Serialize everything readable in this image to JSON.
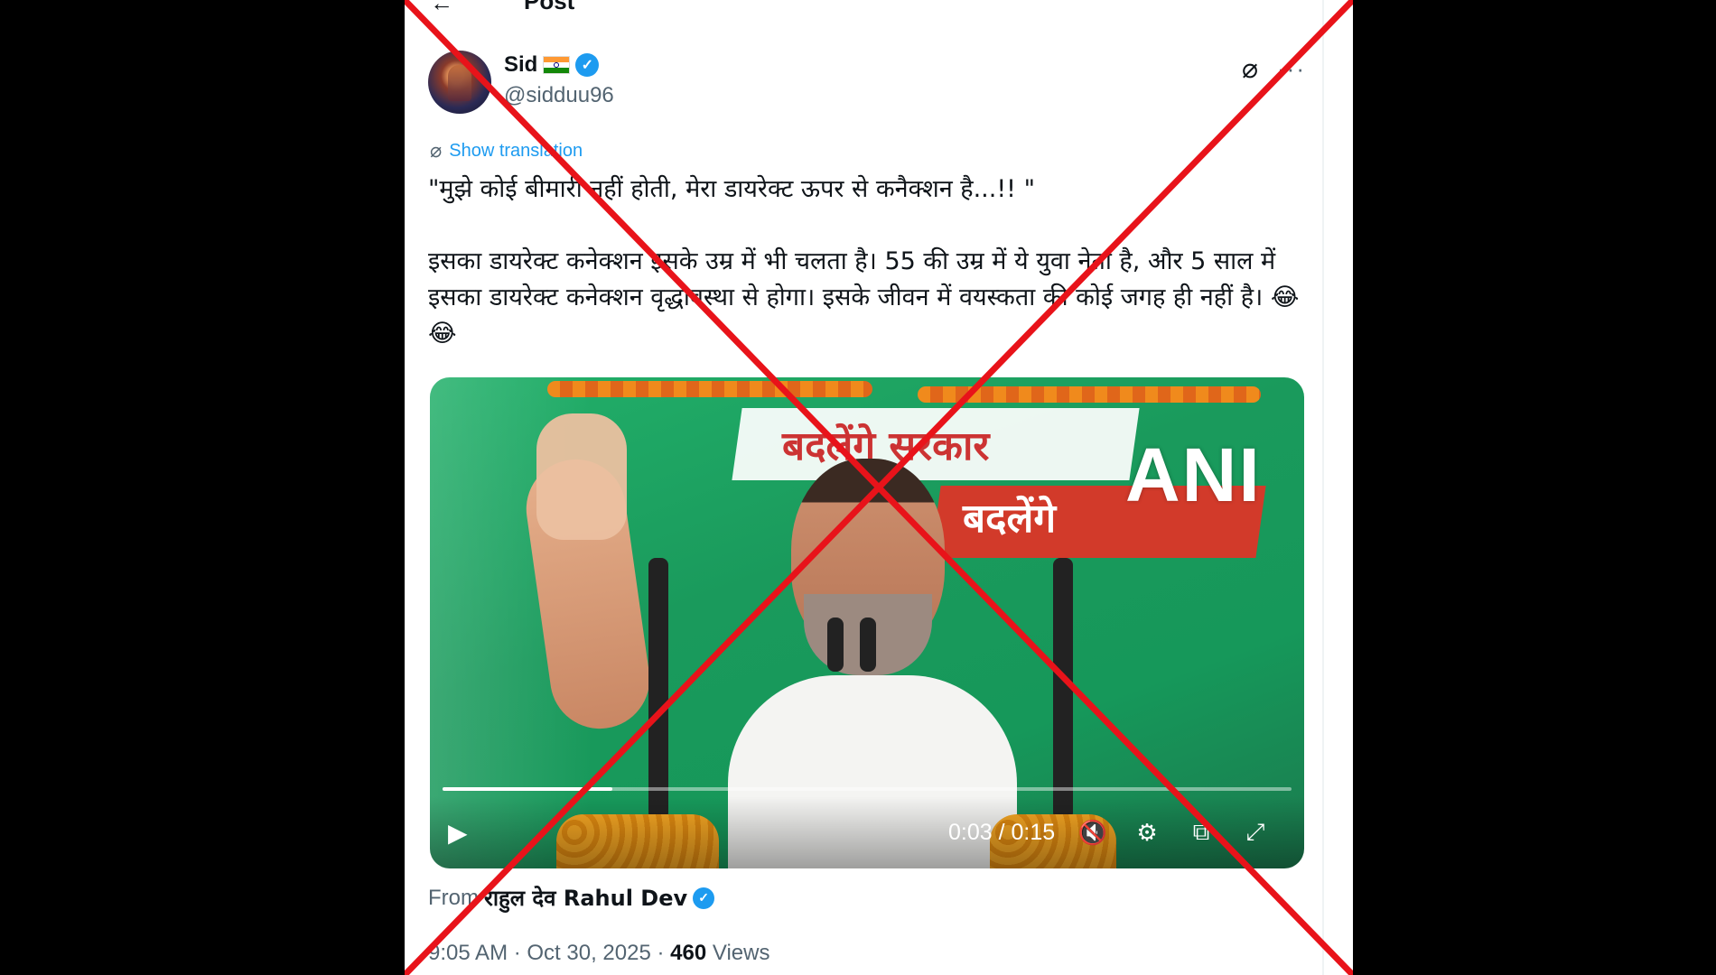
{
  "header": {
    "title": "Post"
  },
  "author": {
    "name": "Sid",
    "handle": "@sidduu96"
  },
  "icons": {
    "back": "arrow-left-icon",
    "grok": "grok-icon",
    "more": "more-dots-icon",
    "translate": "translate-icon",
    "play": "play-icon",
    "mute": "mute-icon",
    "settings": "settings-icon",
    "pip": "pip-icon",
    "fullscreen": "fullscreen-icon"
  },
  "tweet": {
    "translate_label": "Show translation",
    "line1": "\"मुझे कोई बीमारी नहीं होती, मेरा डायरेक्ट ऊपर से कनैक्शन है...!! \"",
    "line2": "इसका डायरेक्ट कनेक्शन इसके उम्र में भी चलता है। 55 की उम्र में ये युवा नेता है, और 5 साल में इसका डायरेक्ट कनेक्शन वृद्धावस्था से होगा। इसके जीवन में वयस्कता की कोई जगह ही नहीं है। 😂😂"
  },
  "video": {
    "banner_line1": "बदलेंगे सरकार",
    "banner_line2": "बदलेंगे",
    "watermark": "ANI",
    "time_current": "0:03",
    "time_separator": " / ",
    "time_total": "0:15",
    "progress": 0.2
  },
  "attribution": {
    "from_label": "From",
    "from_name": "राहुल देव Rahul Dev"
  },
  "meta": {
    "time": "9:05 AM",
    "sep": " · ",
    "date": "Oct 30, 2025",
    "views_count": "460",
    "views_label": "Views"
  },
  "colors": {
    "accent": "#1d9bf0",
    "overlay_red": "#e8131a",
    "video_green": "#1a9a5c"
  }
}
